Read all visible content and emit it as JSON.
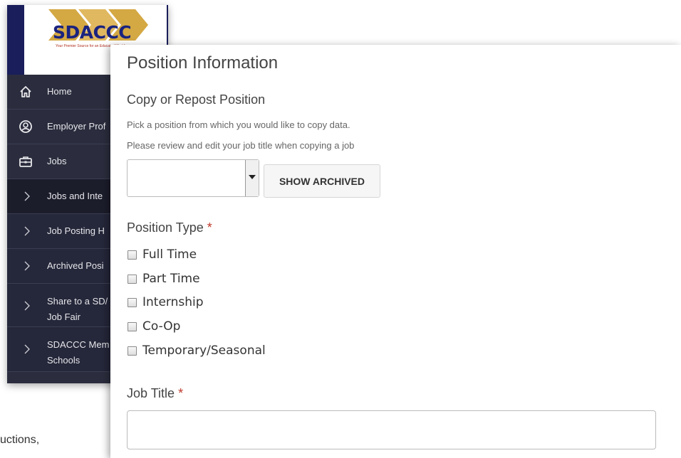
{
  "sidebar": {
    "logo_text": "SDACCC",
    "logo_tagline": "Your Premier Source for an Educated Workforce",
    "items": [
      {
        "label": "Home",
        "icon": "home-icon"
      },
      {
        "label": "Employer Prof",
        "icon": "user-circle-icon"
      },
      {
        "label": "Jobs",
        "icon": "briefcase-icon"
      },
      {
        "label": "Jobs and Inte",
        "icon": "chevron-right-icon"
      },
      {
        "label": "Job Posting H",
        "icon": "chevron-right-icon"
      },
      {
        "label": "Archived Posi",
        "icon": "chevron-right-icon"
      },
      {
        "label": "Share to a SD/\nJob Fair",
        "icon": "chevron-right-icon"
      },
      {
        "label": "SDACCC Mem\nSchools",
        "icon": "chevron-right-icon"
      }
    ]
  },
  "background_text": "uctions,",
  "form": {
    "title": "Position Information",
    "copy_heading": "Copy or Repost Position",
    "hint_1": "Pick a position from which you would like to copy data.",
    "hint_2": "Please review and edit your job title when copying a job",
    "select_value": "",
    "show_archived_label": "SHOW ARCHIVED",
    "position_type_label": "Position Type",
    "required_mark": "*",
    "position_types": [
      "Full Time",
      "Part Time",
      "Internship",
      "Co-Op",
      "Temporary/Seasonal"
    ],
    "job_title_label": "Job Title",
    "job_title_value": ""
  },
  "colors": {
    "sidebar_bg": "#2b2d3e",
    "logo_frame": "#1a1e5a",
    "required": "#c0392b"
  }
}
